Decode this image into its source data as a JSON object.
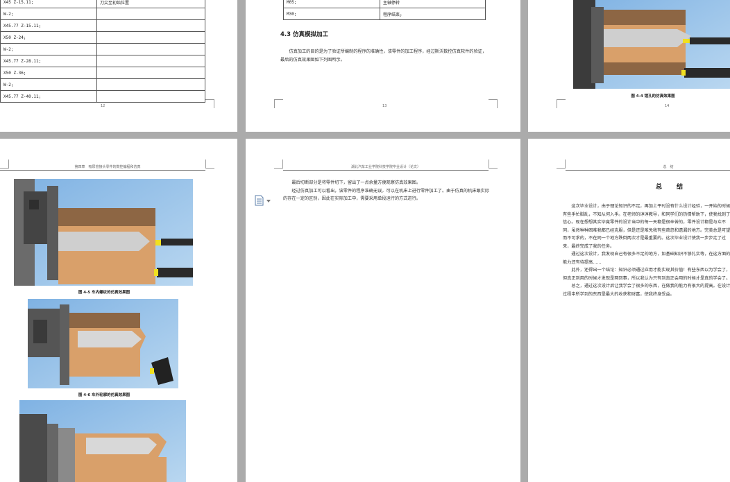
{
  "pages": {
    "p12": {
      "rows": [
        [
          "X45 Z-15.11;",
          "刀尖至初始位置"
        ],
        [
          "W-2;",
          ""
        ],
        [
          "X45.77 Z-15.11;",
          ""
        ],
        [
          "X50 Z-24;",
          ""
        ],
        [
          "W-2;",
          ""
        ],
        [
          "X45.77 Z-28.11;",
          ""
        ],
        [
          "X50 Z-36;",
          ""
        ],
        [
          "W-2;",
          ""
        ],
        [
          "X45.77 Z-40.11;",
          ""
        ]
      ],
      "page_number": "12"
    },
    "p13": {
      "rows": [
        [
          "M05;",
          "主轴停转"
        ],
        [
          "M30;",
          "程序结束;"
        ]
      ],
      "heading": "4.3 仿真模拟加工",
      "paragraph": "仿真加工的目的是为了验证所编制的程序的准确性，该零件的加工程序，经过斯沃数控仿真软件的验证，最后的仿真效果图如下列图所示。",
      "page_number": "13"
    },
    "p14": {
      "caption": "图 4-4 镗孔的仿真效果图",
      "page_number": "14"
    },
    "p15": {
      "header": "第四章　吸尿管接头零件的数控编程和仿真",
      "caption1": "图 4-5 车内螺纹的仿真效果图",
      "caption2": "图 4-6 车外轮廓的仿真效果图"
    },
    "p16": {
      "header": "湖北汽车工业学院科技学院毕业设计（论文）",
      "para1": "最后切断部分是将零件切下，留出了一点余量方便观察仿真效果图。",
      "para2": "经过仿真加工可以看出，该零件的程序准确无误，可以在机床上进行零件加工了。由于仿真的机床跟实际的存在一定的区别，因此在实际加工中，需要采用单段运行的方式进行。"
    },
    "p17": {
      "header": "总　结",
      "title": "总　结",
      "paras": [
        "这次毕业设计，由于理论知识的不足，再加上平时没有什么设计经验，一开始的时候有些手忙脚乱，不知从何入手。在老师的谆谆教导，和同学们的热情帮助下，使我找到了信心。现在想想其实毕竟零件的设计当中的每一天都是很辛苦的，零件设计都是与众不同，虽然种种困难我都已经克服，但是还是难免我有些疏忽和遗漏的地方。完美总是可望而不可求的，不在同一个地方跌倒两次才是最重要的。这次毕业设计使我一步步走了过来，最终完成了我的任务。",
        "通过这次设计，我发现自己有很多不足的地方，如基础知识不够扎实等，在这方面的能力还有待提高……",
        "此外，还得出一个结论：知识必须通过应用才能实现其价值！有些东西以为学会了，但真正到用的时候才发现是两回事，所以我认为只有到真正会用的时候才是真的学会了。",
        "总之，通过这次设计后让我学会了很多的东西，在做我的能力有很大的提高。在设计过程中所学到的东西是最大的收获和财富，使我终身受益。"
      ]
    }
  },
  "colors": {
    "page_bg": "#ffffff",
    "app_bg": "#ababab",
    "sky": "#8fbde8",
    "part_orange": "#e0a065",
    "part_brown": "#9c6f48",
    "chuck": "#555555",
    "tool_yellow": "#f0e020"
  }
}
